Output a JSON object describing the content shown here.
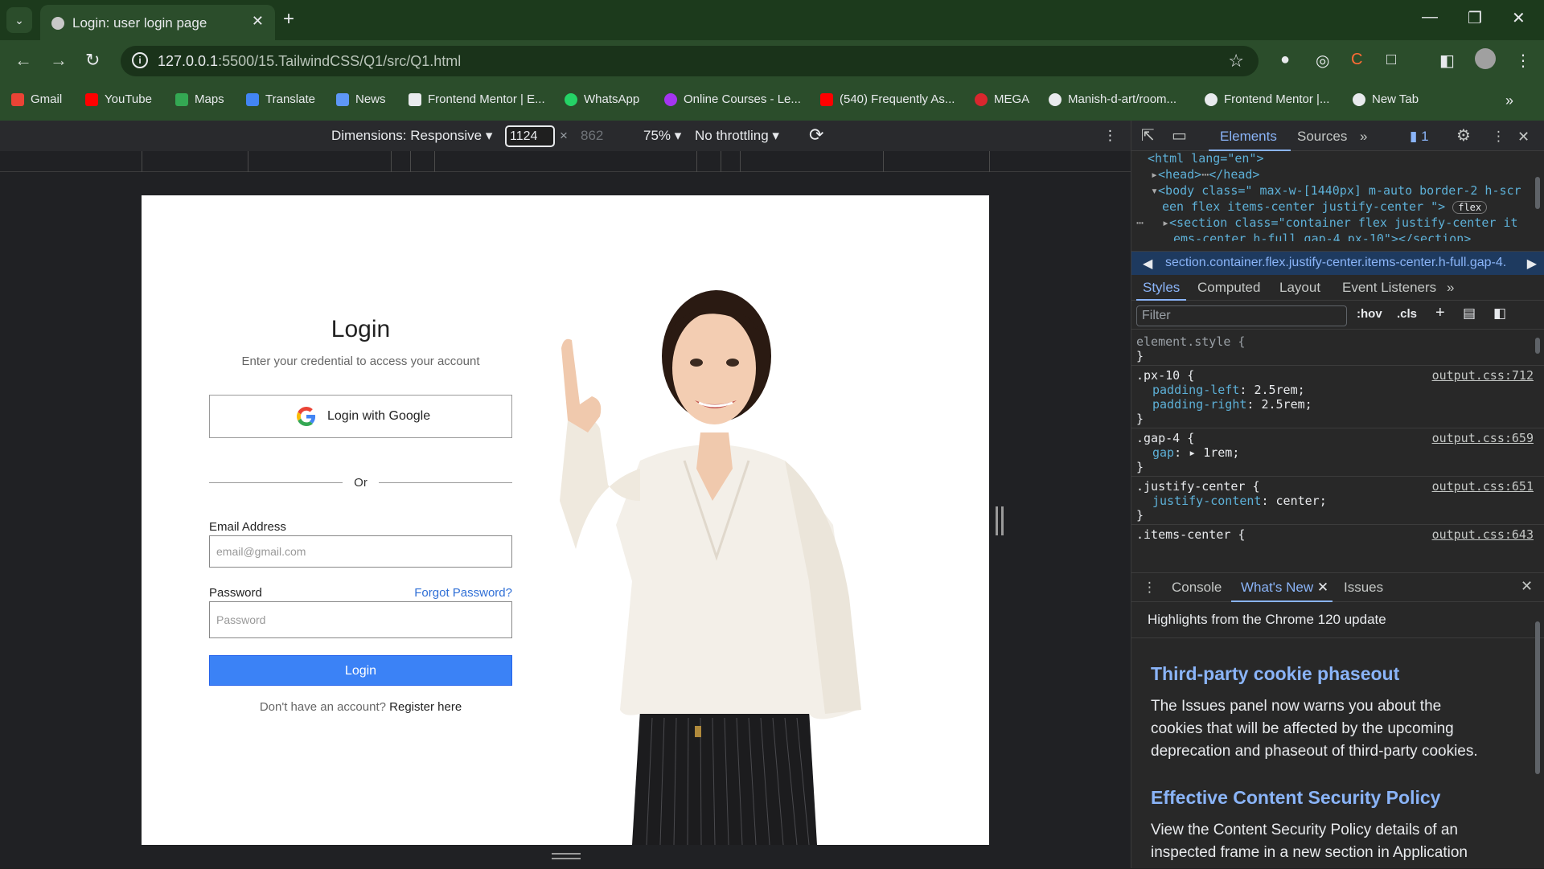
{
  "browser": {
    "tab_title": "Login: user login page",
    "url_host": "127.0.0.1",
    "url_path": ":5500/15.TailwindCSS/Q1/src/Q1.html",
    "bookmarks": [
      {
        "label": "Gmail",
        "color": "#ea4335"
      },
      {
        "label": "YouTube",
        "color": "#ff0000"
      },
      {
        "label": "Maps",
        "color": "#34a853"
      },
      {
        "label": "Translate",
        "color": "#4285f4"
      },
      {
        "label": "News",
        "color": "#5e97f6"
      },
      {
        "label": "Frontend Mentor | E...",
        "color": "#e8eaed"
      },
      {
        "label": "WhatsApp",
        "color": "#25d366"
      },
      {
        "label": "Online Courses - Le...",
        "color": "#a435f0"
      },
      {
        "label": "(540) Frequently As...",
        "color": "#ff0000"
      },
      {
        "label": "MEGA",
        "color": "#d9272e"
      },
      {
        "label": "Manish-d-art/room...",
        "color": "#e8eaed"
      },
      {
        "label": "Frontend Mentor |...",
        "color": "#e8eaed"
      },
      {
        "label": "New Tab",
        "color": "#e8eaed"
      }
    ]
  },
  "device_toolbar": {
    "dimensions": "Dimensions: Responsive",
    "width": "1124",
    "height": "862",
    "zoom": "75%",
    "throttling": "No throttling"
  },
  "page": {
    "title": "Login",
    "subtitle": "Enter your credential to access your account",
    "google_label": "Login with Google",
    "or": "Or",
    "email_label": "Email Address",
    "email_placeholder": "email@gmail.com",
    "password_label": "Password",
    "forgot": "Forgot Password?",
    "password_placeholder": "Password",
    "login_button": "Login",
    "register_prompt": "Don't have an account?",
    "register_link": "Register here"
  },
  "devtools": {
    "tabs": [
      "Elements",
      "Sources"
    ],
    "issue_count": "1",
    "dom": {
      "html_line": "<html lang=\"en\">",
      "head_line": "<head>",
      "head_close": "</head>",
      "body_line": "<body class=\" max-w-[1440px] m-auto border-2 h-scr",
      "body_line2": "een flex items-center justify-center \">",
      "flex_badge": "flex",
      "section_line": "<section class=\"container flex justify-center it",
      "section_line2": "ems-center h-full gap-4 px-10\">",
      "section_close": "</section>"
    },
    "breadcrumb": "section.container.flex.justify-center.items-center.h-full.gap-4.",
    "style_tabs": [
      "Styles",
      "Computed",
      "Layout",
      "Event Listeners"
    ],
    "filter_placeholder": "Filter",
    "hov": ":hov",
    "cls": ".cls",
    "rules": {
      "element_style": "element.style {",
      "px10_selector": ".px-10 {",
      "px10_source": "output.css:712",
      "px10_prop1": "padding-left",
      "px10_val1": "2.5rem;",
      "px10_prop2": "padding-right",
      "px10_val2": "2.5rem;",
      "gap4_selector": ".gap-4 {",
      "gap4_source": "output.css:659",
      "gap4_prop": "gap",
      "gap4_val": "1rem;",
      "jc_selector": ".justify-center {",
      "jc_source": "output.css:651",
      "jc_prop": "justify-content",
      "jc_val": "center;",
      "ic_selector": ".items-center {",
      "ic_source": "output.css:643",
      "close_brace": "}"
    },
    "drawer": {
      "tabs": [
        "Console",
        "What's New",
        "Issues"
      ],
      "heading": "Highlights from the Chrome 120 update",
      "h2_1": "Third-party cookie phaseout",
      "p_1": "The Issues panel now warns you about the cookies that will be affected by the upcoming deprecation and phaseout of third-party cookies.",
      "h2_2": "Effective Content Security Policy",
      "p_2": "View the Content Security Policy details of an inspected frame in a new section in Application"
    }
  }
}
